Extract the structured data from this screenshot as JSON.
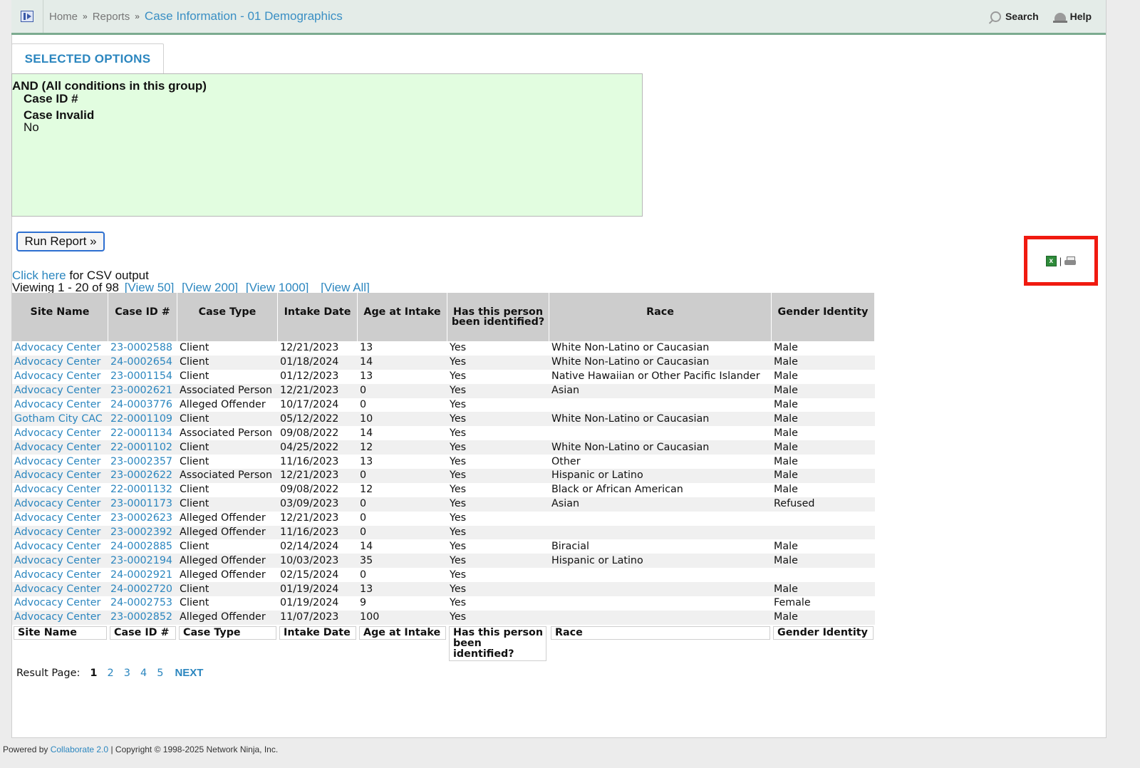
{
  "header": {
    "breadcrumb": [
      "Home",
      "Reports"
    ],
    "separator": "»",
    "current": "Case Information - 01 Demographics",
    "search_label": "Search",
    "help_label": "Help"
  },
  "tab": {
    "label": "SELECTED OPTIONS"
  },
  "criteria": {
    "group": "AND (All conditions in this group)",
    "lines": [
      "Case ID #",
      "Case Invalid",
      "No"
    ]
  },
  "run_button": "Run Report »",
  "export": {
    "excel_icon": "excel-icon",
    "separator": "|",
    "print_icon": "printer-icon",
    "highlight_color": "#f01a10"
  },
  "csv": {
    "link": "Click here",
    "suffix": "for CSV output"
  },
  "viewing": {
    "text": "Viewing 1 - 20 of 98",
    "links": [
      "[View 50]",
      "[View 200]",
      "[View 1000]",
      "[View All]"
    ]
  },
  "table": {
    "headers": [
      "Site Name",
      "Case ID #",
      "Case Type",
      "Intake Date",
      "Age at Intake",
      "Has this person been identified?",
      "Race",
      "Gender Identity"
    ],
    "rows": [
      [
        "Advocacy Center",
        "23-0002588",
        "Client",
        "12/21/2023",
        "13",
        "Yes",
        "White Non-Latino or Caucasian",
        "Male"
      ],
      [
        "Advocacy Center",
        "24-0002654",
        "Client",
        "01/18/2024",
        "14",
        "Yes",
        "White Non-Latino or Caucasian",
        "Male"
      ],
      [
        "Advocacy Center",
        "23-0001154",
        "Client",
        "01/12/2023",
        "13",
        "Yes",
        "Native Hawaiian or Other Pacific Islander",
        "Male"
      ],
      [
        "Advocacy Center",
        "23-0002621",
        "Associated Person",
        "12/21/2023",
        "0",
        "Yes",
        "Asian",
        "Male"
      ],
      [
        "Advocacy Center",
        "24-0003776",
        "Alleged Offender",
        "10/17/2024",
        "0",
        "Yes",
        "",
        "Male"
      ],
      [
        "Gotham City CAC",
        "22-0001109",
        "Client",
        "05/12/2022",
        "10",
        "Yes",
        "White Non-Latino or Caucasian",
        "Male"
      ],
      [
        "Advocacy Center",
        "22-0001134",
        "Associated Person",
        "09/08/2022",
        "14",
        "Yes",
        "",
        "Male"
      ],
      [
        "Advocacy Center",
        "22-0001102",
        "Client",
        "04/25/2022",
        "12",
        "Yes",
        "White Non-Latino or Caucasian",
        "Male"
      ],
      [
        "Advocacy Center",
        "23-0002357",
        "Client",
        "11/16/2023",
        "13",
        "Yes",
        "Other",
        "Male"
      ],
      [
        "Advocacy Center",
        "23-0002622",
        "Associated Person",
        "12/21/2023",
        "0",
        "Yes",
        "Hispanic or Latino",
        "Male"
      ],
      [
        "Advocacy Center",
        "22-0001132",
        "Client",
        "09/08/2022",
        "12",
        "Yes",
        "Black or African American",
        "Male"
      ],
      [
        "Advocacy Center",
        "23-0001173",
        "Client",
        "03/09/2023",
        "0",
        "Yes",
        "Asian",
        "Refused"
      ],
      [
        "Advocacy Center",
        "23-0002623",
        "Alleged Offender",
        "12/21/2023",
        "0",
        "Yes",
        "",
        ""
      ],
      [
        "Advocacy Center",
        "23-0002392",
        "Alleged Offender",
        "11/16/2023",
        "0",
        "Yes",
        "",
        ""
      ],
      [
        "Advocacy Center",
        "24-0002885",
        "Client",
        "02/14/2024",
        "14",
        "Yes",
        "Biracial",
        "Male"
      ],
      [
        "Advocacy Center",
        "23-0002194",
        "Alleged Offender",
        "10/03/2023",
        "35",
        "Yes",
        "Hispanic or Latino",
        "Male"
      ],
      [
        "Advocacy Center",
        "24-0002921",
        "Alleged Offender",
        "02/15/2024",
        "0",
        "Yes",
        "",
        ""
      ],
      [
        "Advocacy Center",
        "24-0002720",
        "Client",
        "01/19/2024",
        "13",
        "Yes",
        "",
        "Male"
      ],
      [
        "Advocacy Center",
        "24-0002753",
        "Client",
        "01/19/2024",
        "9",
        "Yes",
        "",
        "Female"
      ],
      [
        "Advocacy Center",
        "23-0002852",
        "Alleged Offender",
        "11/07/2023",
        "100",
        "Yes",
        "",
        "Male"
      ]
    ]
  },
  "pagination": {
    "label": "Result Page:",
    "pages": [
      "1",
      "2",
      "3",
      "4",
      "5"
    ],
    "current": "1",
    "next": "NEXT"
  },
  "footer": {
    "prefix": "Powered by",
    "link": "Collaborate 2.0",
    "suffix": "| Copyright © 1998-2025 Network Ninja, Inc."
  }
}
